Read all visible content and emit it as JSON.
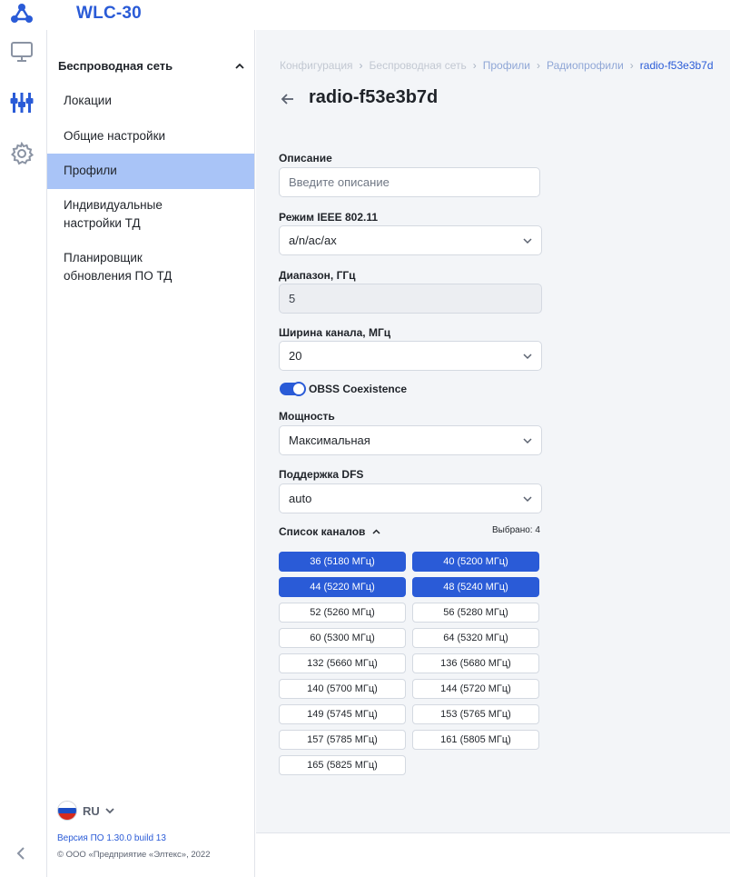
{
  "app": {
    "title": "WLC-30"
  },
  "rail": {
    "items": [
      {
        "icon": "monitor-icon"
      },
      {
        "icon": "equalizer-icon"
      },
      {
        "icon": "gear-icon"
      }
    ],
    "collapse_icon": "chevron-left-icon"
  },
  "sidebar": {
    "section_title": "Беспроводная сеть",
    "items": [
      {
        "label": "Локации"
      },
      {
        "label": "Общие настройки"
      },
      {
        "label": "Профили"
      },
      {
        "label": "Индивидуальные настройки ТД"
      },
      {
        "label": "Планировщик обновления ПО ТД"
      }
    ],
    "lang": "RU",
    "version": "Версия ПО 1.30.0 build 13",
    "copyright": "© ООО «Предприятие «Элтекс», 2022"
  },
  "breadcrumb": {
    "items": [
      "Конфигурация",
      "Беспроводная сеть",
      "Профили",
      "Радиопрофили",
      "radio-f53e3b7d"
    ]
  },
  "page": {
    "title": "radio-f53e3b7d"
  },
  "form": {
    "description": {
      "label": "Описание",
      "placeholder": "Введите описание"
    },
    "ieee": {
      "label": "Режим IEEE 802.11",
      "value": "a/n/ac/ax"
    },
    "band": {
      "label": "Диапазон, ГГц",
      "value": "5"
    },
    "width": {
      "label": "Ширина канала, МГц",
      "value": "20"
    },
    "obss": {
      "label": "OBSS Coexistence",
      "enabled": true
    },
    "power": {
      "label": "Мощность",
      "value": "Максимальная"
    },
    "dfs": {
      "label": "Поддержка DFS",
      "value": "auto"
    },
    "channels": {
      "label": "Список каналов",
      "selected_text": "Выбрано: 4",
      "items": [
        {
          "label": "36 (5180 МГц)",
          "selected": true
        },
        {
          "label": "40 (5200 МГц)",
          "selected": true
        },
        {
          "label": "44 (5220 МГц)",
          "selected": true
        },
        {
          "label": "48 (5240 МГц)",
          "selected": true
        },
        {
          "label": "52 (5260 МГц)",
          "selected": false
        },
        {
          "label": "56 (5280 МГц)",
          "selected": false
        },
        {
          "label": "60 (5300 МГц)",
          "selected": false
        },
        {
          "label": "64 (5320 МГц)",
          "selected": false
        },
        {
          "label": "132 (5660 МГц)",
          "selected": false
        },
        {
          "label": "136 (5680 МГц)",
          "selected": false
        },
        {
          "label": "140 (5700 МГц)",
          "selected": false
        },
        {
          "label": "144 (5720 МГц)",
          "selected": false
        },
        {
          "label": "149 (5745 МГц)",
          "selected": false
        },
        {
          "label": "153 (5765 МГц)",
          "selected": false
        },
        {
          "label": "157 (5785 МГц)",
          "selected": false
        },
        {
          "label": "161 (5805 МГц)",
          "selected": false
        },
        {
          "label": "165 (5825 МГц)",
          "selected": false
        }
      ]
    }
  },
  "colors": {
    "accent": "#2a5bd7",
    "active_nav": "#a9c4f7",
    "main_bg": "#f3f5f8"
  }
}
